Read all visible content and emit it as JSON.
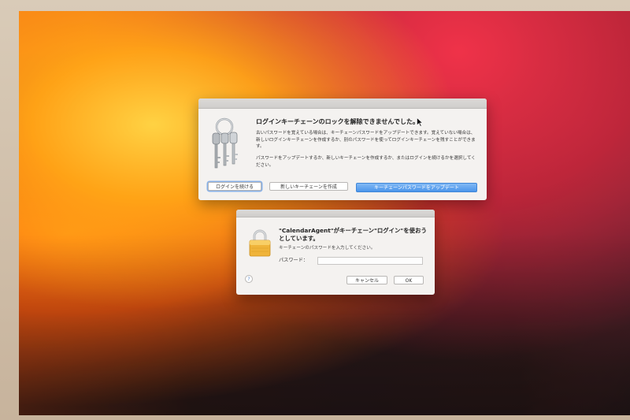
{
  "keychain_dialog": {
    "title": "ログインキーチェーンのロックを解除できませんでした。",
    "body_line1": "古いパスワードを覚えている場合は、キーチェーンパスワードをアップデートできます。覚えていない場合は、新しいログインキーチェーンを作成するか、別のパスワードを使ってログインキーチェーンを残すことができます。",
    "body_line2": "パスワードをアップデートするか、新しいキーチェーンを作成するか、またはログインを続けるかを選択してください。",
    "buttons": {
      "continue_login": "ログインを続ける",
      "new_keychain": "新しいキーチェーンを作成",
      "update_password": "キーチェーンパスワードをアップデート"
    }
  },
  "password_dialog": {
    "title": "\"CalendarAgent\"がキーチェーン\"ログイン\"を使おうとしています。",
    "subtitle": "キーチェーンのパスワードを入力してください。",
    "password_label": "パスワード：",
    "password_value": "",
    "help_label": "?",
    "buttons": {
      "cancel": "キャンセル",
      "ok": "OK"
    }
  },
  "colors": {
    "accent": "#4b95ea",
    "dialog_bg": "#f4f2f0",
    "lock_gold": "#f0b43a"
  },
  "icons": {
    "keychain": "keys-icon",
    "lock": "lock-icon",
    "help": "help-icon",
    "cursor": "cursor-arrow-icon"
  }
}
